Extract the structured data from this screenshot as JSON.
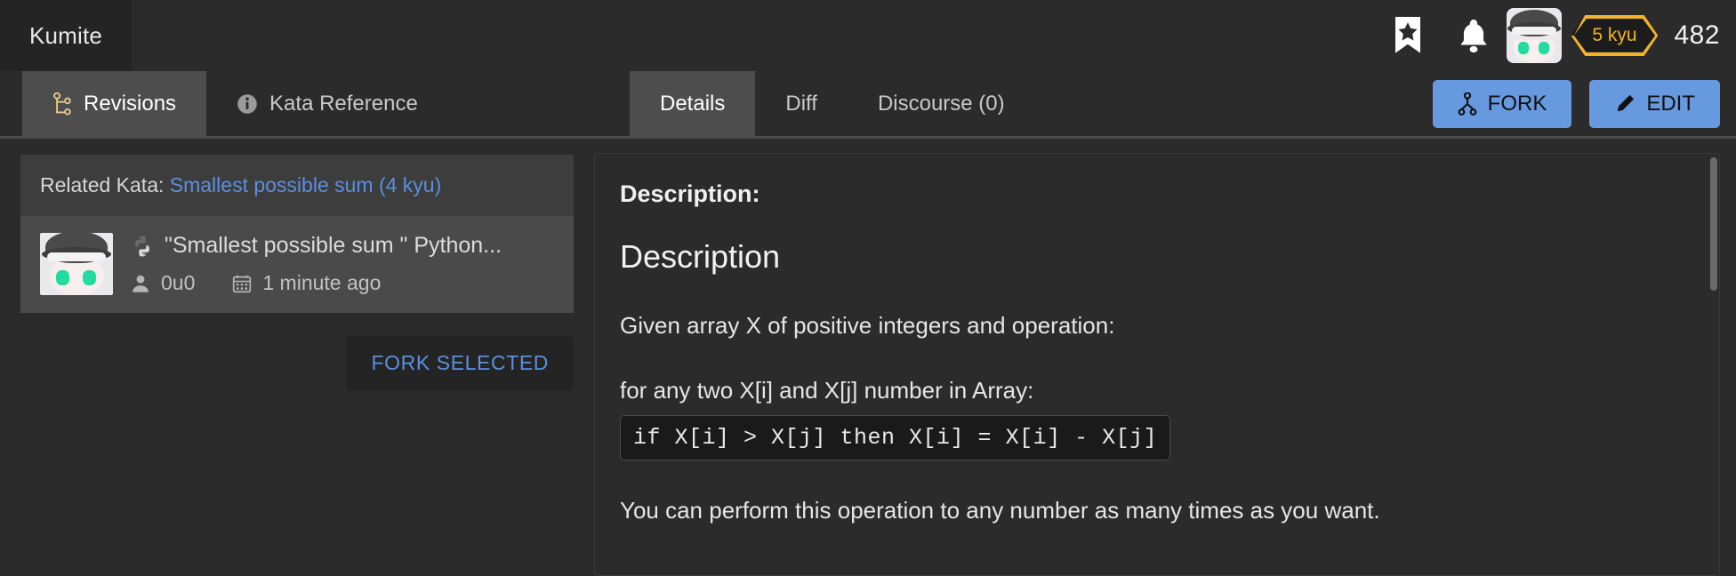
{
  "header": {
    "brand": "Kumite",
    "icons": [
      {
        "name": "bookmark-star-icon",
        "label": "Bookmarks"
      },
      {
        "name": "bell-icon",
        "label": "Notifications"
      }
    ],
    "avatar_name": "avatar",
    "rank": "5 kyu",
    "honor": "482"
  },
  "left_panel": {
    "tabs": [
      {
        "id": "revisions",
        "label": "Revisions",
        "icon": "branch-icon",
        "active": true
      },
      {
        "id": "kata-reference",
        "label": "Kata Reference",
        "icon": "info-icon",
        "active": false
      }
    ],
    "related_kata_prefix": "Related Kata:",
    "related_kata_link": "Smallest possible sum (4 kyu)",
    "revision": {
      "title": "\"Smallest possible sum \" Python...",
      "language_icon": "python-icon",
      "author": "0u0",
      "author_icon": "user-icon",
      "time": "1 minute ago",
      "time_icon": "calendar-icon"
    },
    "fork_selected_label": "FORK SELECTED"
  },
  "main_panel": {
    "tabs": [
      {
        "id": "details",
        "label": "Details",
        "active": true
      },
      {
        "id": "diff",
        "label": "Diff",
        "active": false
      },
      {
        "id": "discourse",
        "label": "Discourse (0)",
        "active": false
      }
    ],
    "fork_button": {
      "label": "FORK",
      "icon": "fork-icon"
    },
    "edit_button": {
      "label": "EDIT",
      "icon": "pencil-icon"
    },
    "description": {
      "label": "Description:",
      "heading": "Description",
      "paragraph_1": "Given array X of positive integers and operation:",
      "paragraph_2": "for any two X[i] and X[j] number in Array:",
      "code": "if X[i] > X[j] then X[i] = X[i] - X[j]",
      "paragraph_3": "You can perform this operation to any number as many times as you want."
    }
  },
  "colors": {
    "page_bg": "#2b2b2b",
    "panel_bg": "#3d3d3d",
    "active_tab_bg": "#4d4d4d",
    "accent_blue": "#6699e0",
    "link_blue": "#5b8fe0",
    "rank_gold": "#f0b429",
    "highlight_red": "#fb0303"
  }
}
